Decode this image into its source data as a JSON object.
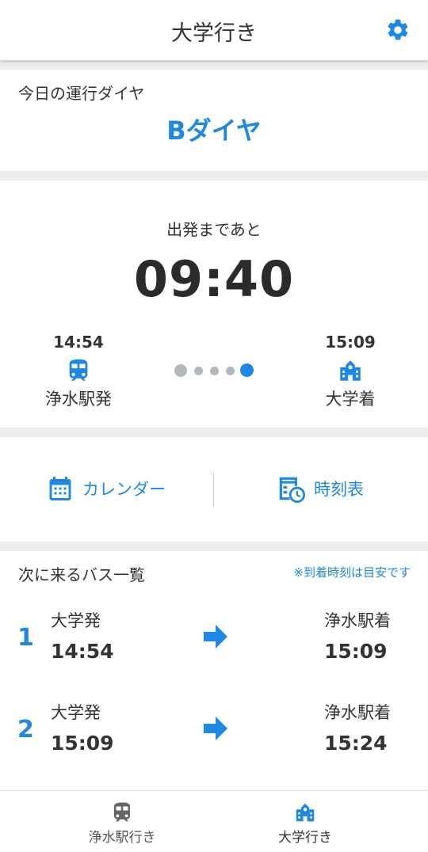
{
  "header": {
    "title": "大学行き"
  },
  "diagram": {
    "label": "今日の運行ダイヤ",
    "value": "Bダイヤ"
  },
  "countdown": {
    "label": "出発まであと",
    "time": "09:40",
    "departure": {
      "time": "14:54",
      "name": "浄水駅発",
      "icon": "train-icon"
    },
    "arrival": {
      "time": "15:09",
      "name": "大学着",
      "icon": "university-icon"
    },
    "progress": {
      "total_dots": 5,
      "active_dot": 5
    }
  },
  "actions": {
    "calendar_label": "カレンダー",
    "timetable_label": "時刻表"
  },
  "bus_list": {
    "title": "次に来るバス一覧",
    "note": "※到着時刻は目安です",
    "rows": [
      {
        "index": "1",
        "dep_place": "大学発",
        "dep_time": "14:54",
        "arr_place": "浄水駅着",
        "arr_time": "15:09"
      },
      {
        "index": "2",
        "dep_place": "大学発",
        "dep_time": "15:09",
        "arr_place": "浄水駅着",
        "arr_time": "15:24"
      }
    ]
  },
  "tabs": [
    {
      "label": "浄水駅行き",
      "icon": "train-icon",
      "active": false
    },
    {
      "label": "大学行き",
      "icon": "university-icon",
      "active": true
    }
  ],
  "colors": {
    "accent": "#1e88e5",
    "inactive_dot": "#b0b7bd",
    "text": "#333333"
  }
}
